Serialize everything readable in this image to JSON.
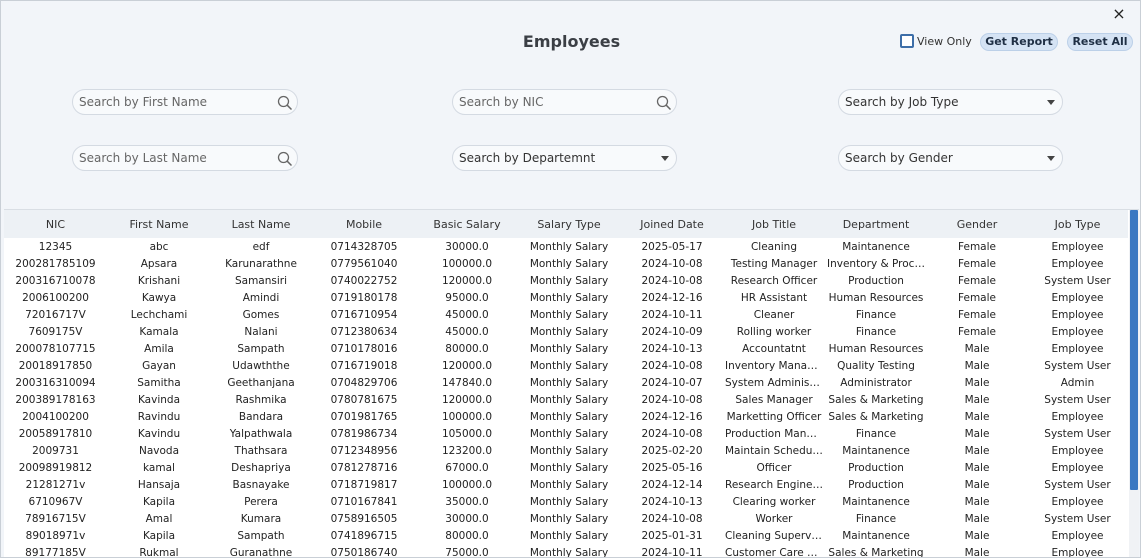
{
  "window": {
    "title": "Employees",
    "close_icon": "×"
  },
  "toolbar": {
    "view_only_label": "View Only",
    "get_report_label": "Get Report",
    "reset_all_label": "Reset All"
  },
  "filters": {
    "first_name_placeholder": "Search by First Name",
    "last_name_placeholder": "Search by Last Name",
    "nic_placeholder": "Search by NIC",
    "department_select": "Search by Departemnt",
    "job_type_select": "Search by Job Type",
    "gender_select": "Search by Gender"
  },
  "table": {
    "columns": [
      "NIC",
      "First Name",
      "Last Name",
      "Mobile",
      "Basic Salary",
      "Salary Type",
      "Joined Date",
      "Job Title",
      "Department",
      "Gender",
      "Job Type"
    ],
    "rows": [
      [
        "12345",
        "abc",
        "edf",
        "0714328705",
        "30000.0",
        "Monthly Salary",
        "2025-05-17",
        "Cleaning",
        "Maintanence",
        "Female",
        "Employee"
      ],
      [
        "200281785109",
        "Apsara",
        "Karunarathne",
        "0779561040",
        "100000.0",
        "Monthly Salary",
        "2024-10-08",
        "Testing Manager",
        "Inventory & Procur...",
        "Female",
        "Employee"
      ],
      [
        "200316710078",
        "Krishani",
        "Samansiri",
        "0740022752",
        "120000.0",
        "Monthly Salary",
        "2024-10-08",
        "Research Officer",
        "Production",
        "Female",
        "System User"
      ],
      [
        "2006100200",
        "Kawya",
        "Amindi",
        "0719180178",
        "95000.0",
        "Monthly Salary",
        "2024-12-16",
        "HR Assistant",
        "Human Resources",
        "Female",
        "Employee"
      ],
      [
        "72016717V",
        "Lechchami",
        "Gomes",
        "0716710954",
        "45000.0",
        "Monthly Salary",
        "2024-10-11",
        "Cleaner",
        "Finance",
        "Female",
        "Employee"
      ],
      [
        "7609175V",
        "Kamala",
        "Nalani",
        "0712380634",
        "45000.0",
        "Monthly Salary",
        "2024-10-09",
        "Rolling worker",
        "Finance",
        "Female",
        "Employee"
      ],
      [
        "200078107715",
        "Amila",
        "Sampath",
        "0710178016",
        "80000.0",
        "Monthly Salary",
        "2024-10-13",
        "Accountatnt",
        "Human Resources",
        "Male",
        "Employee"
      ],
      [
        "20018917850",
        "Gayan",
        "Udawththe",
        "0716719018",
        "120000.0",
        "Monthly Salary",
        "2024-10-08",
        "Inventory Manager",
        "Quality Testing",
        "Male",
        "System User"
      ],
      [
        "200316310094",
        "Samitha",
        "Geethanjana",
        "0704829706",
        "147840.0",
        "Monthly Salary",
        "2024-10-07",
        "System Administrat...",
        "Administrator",
        "Male",
        "Admin"
      ],
      [
        "200389178163",
        "Kavinda",
        "Rashmika",
        "0780781675",
        "120000.0",
        "Monthly Salary",
        "2024-10-08",
        "Sales Manager",
        "Sales & Marketing",
        "Male",
        "System User"
      ],
      [
        "2004100200",
        "Ravindu",
        "Bandara",
        "0701981765",
        "100000.0",
        "Monthly Salary",
        "2024-12-16",
        "Marketting Officer",
        "Sales & Marketing",
        "Male",
        "Employee"
      ],
      [
        "20058917810",
        "Kavindu",
        "Yalpathwala",
        "0781986734",
        "105000.0",
        "Monthly Salary",
        "2024-10-08",
        "Production Manag...",
        "Finance",
        "Male",
        "System User"
      ],
      [
        "2009731",
        "Navoda",
        "Thathsara",
        "0712348956",
        "123200.0",
        "Monthly Salary",
        "2025-02-20",
        "Maintain Schedule ...",
        "Maintanence",
        "Male",
        "Employee"
      ],
      [
        "20098919812",
        "kamal",
        "Deshapriya",
        "0781278716",
        "67000.0",
        "Monthly Salary",
        "2025-05-16",
        "Officer",
        "Production",
        "Male",
        "Employee"
      ],
      [
        "21281271v",
        "Hansaja",
        "Basnayake",
        "0718719817",
        "100000.0",
        "Monthly Salary",
        "2024-12-14",
        "Research Engineer",
        "Production",
        "Male",
        "System User"
      ],
      [
        "6710967V",
        "Kapila",
        "Perera",
        "0710167841",
        "35000.0",
        "Monthly Salary",
        "2024-10-13",
        "Clearing worker",
        "Maintanence",
        "Male",
        "Employee"
      ],
      [
        "78916715V",
        "Amal",
        "Kumara",
        "0758916505",
        "30000.0",
        "Monthly Salary",
        "2024-10-08",
        "Worker",
        "Finance",
        "Male",
        "System User"
      ],
      [
        "89018971v",
        "Kapila",
        "Sampath",
        "0741896715",
        "80000.0",
        "Monthly Salary",
        "2025-01-31",
        "Cleaning Supervisor",
        "Maintanence",
        "Male",
        "Employee"
      ],
      [
        "89177185V",
        "Rukmal",
        "Guranathne",
        "0750186740",
        "75000.0",
        "Monthly Salary",
        "2024-10-11",
        "Customer Care Offi...",
        "Sales & Marketing",
        "Male",
        "Employee"
      ]
    ]
  },
  "icons": {
    "search": "search-icon",
    "dropdown": "chevron-down-icon",
    "close": "close-icon"
  },
  "colors": {
    "accent": "#3a78c2",
    "button_bg": "#d5e3f4",
    "window_bg": "#f2f5f9"
  }
}
